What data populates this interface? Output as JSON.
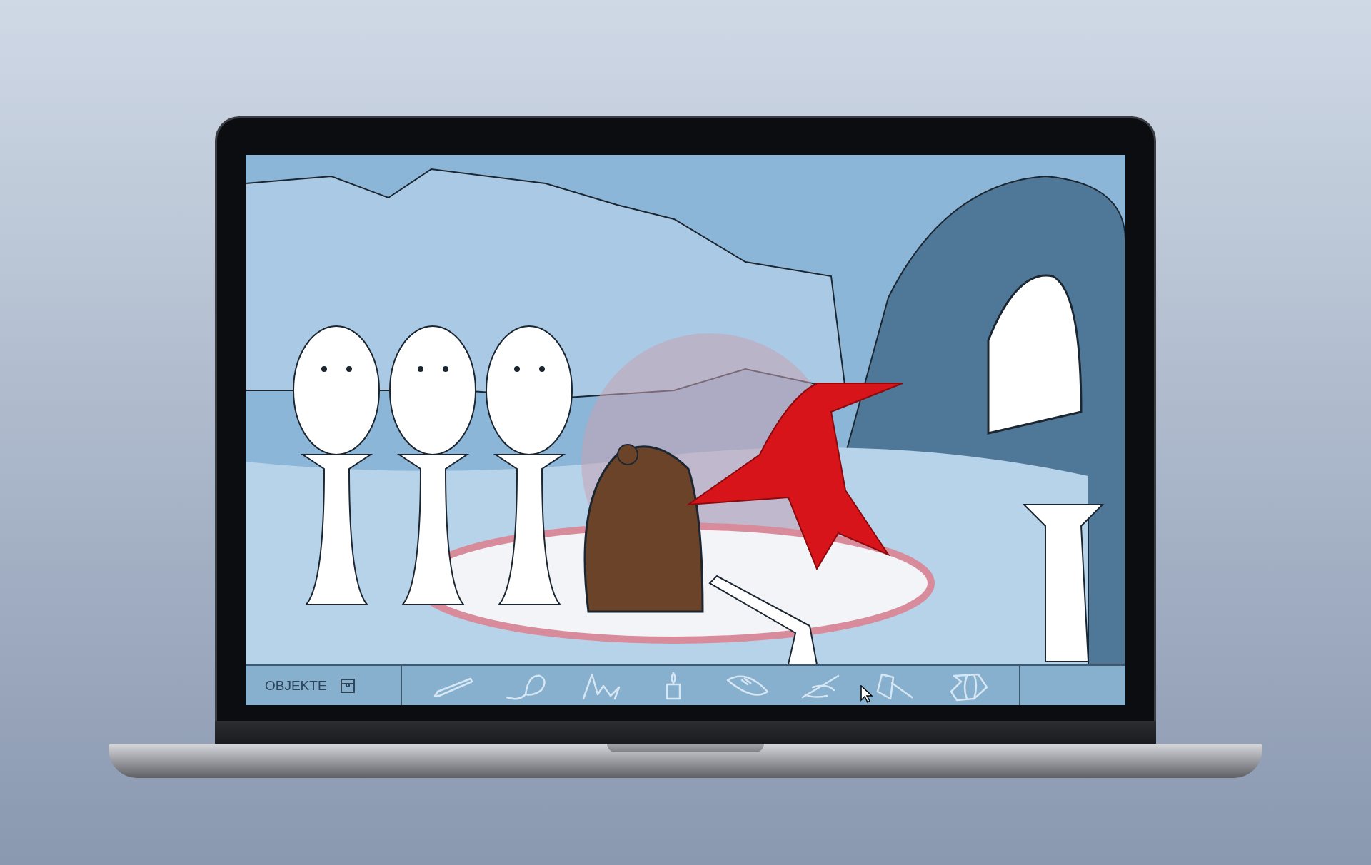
{
  "toolbar": {
    "label": "OBJEKTE"
  }
}
